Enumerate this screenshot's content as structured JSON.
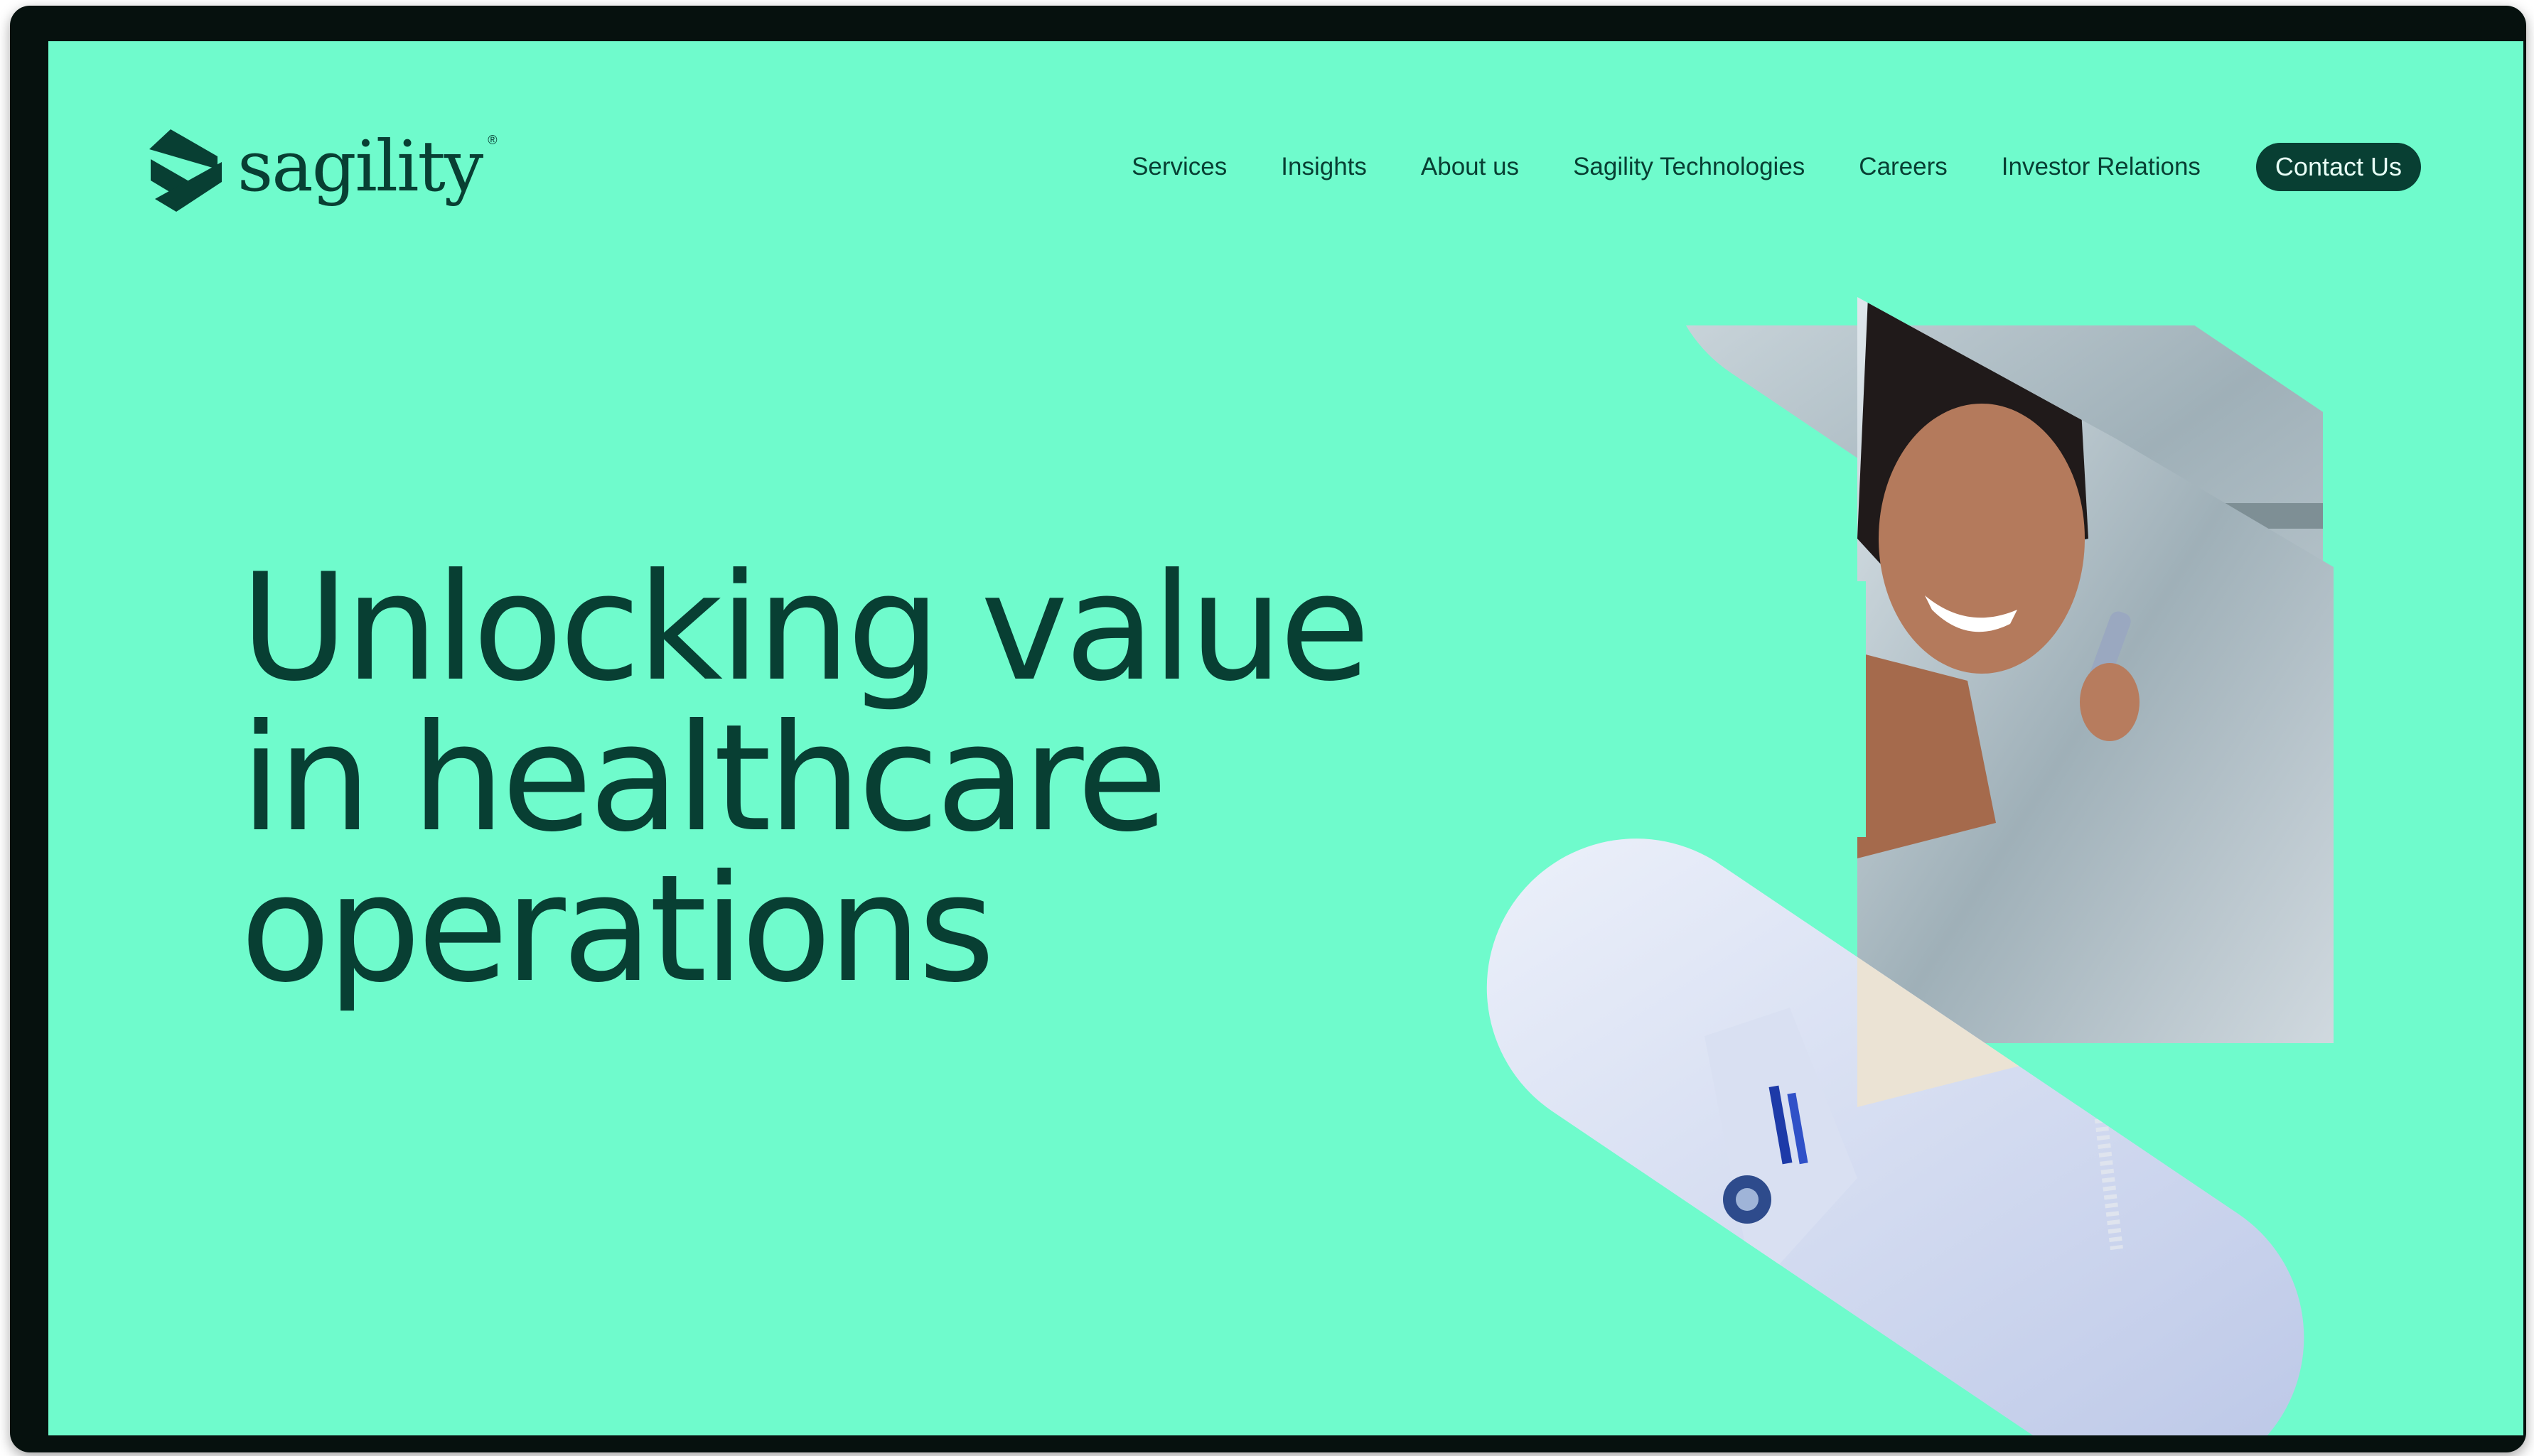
{
  "brand": {
    "name": "sagility",
    "registered_mark": "®",
    "colors": {
      "background": "#6ffbcc",
      "primary": "#083f33",
      "frame": "#06110e"
    }
  },
  "nav": {
    "items": [
      {
        "label": "Services"
      },
      {
        "label": "Insights"
      },
      {
        "label": "About us"
      },
      {
        "label": "Sagility Technologies"
      },
      {
        "label": "Careers"
      },
      {
        "label": "Investor Relations"
      }
    ],
    "cta_label": "Contact Us"
  },
  "hero": {
    "headline_lines": [
      "Unlocking value",
      "in healthcare",
      "operations"
    ],
    "image": "woman-healthcare-professional-on-phone-photo"
  },
  "icons": {
    "logo_mark": "sagility-s-mark-icon"
  }
}
